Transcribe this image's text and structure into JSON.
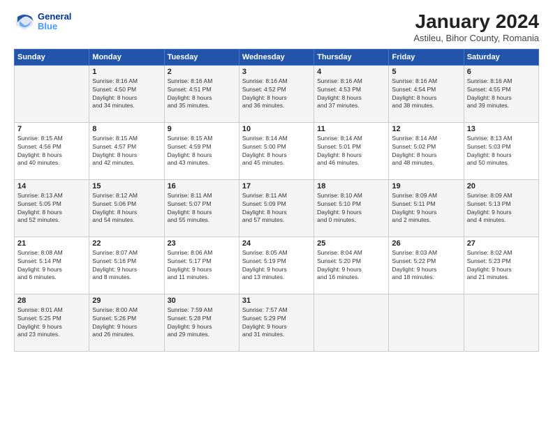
{
  "header": {
    "logo_line1": "General",
    "logo_line2": "Blue",
    "title": "January 2024",
    "subtitle": "Astileu, Bihor County, Romania"
  },
  "days_of_week": [
    "Sunday",
    "Monday",
    "Tuesday",
    "Wednesday",
    "Thursday",
    "Friday",
    "Saturday"
  ],
  "weeks": [
    [
      {
        "day": "",
        "info": ""
      },
      {
        "day": "1",
        "info": "Sunrise: 8:16 AM\nSunset: 4:50 PM\nDaylight: 8 hours\nand 34 minutes."
      },
      {
        "day": "2",
        "info": "Sunrise: 8:16 AM\nSunset: 4:51 PM\nDaylight: 8 hours\nand 35 minutes."
      },
      {
        "day": "3",
        "info": "Sunrise: 8:16 AM\nSunset: 4:52 PM\nDaylight: 8 hours\nand 36 minutes."
      },
      {
        "day": "4",
        "info": "Sunrise: 8:16 AM\nSunset: 4:53 PM\nDaylight: 8 hours\nand 37 minutes."
      },
      {
        "day": "5",
        "info": "Sunrise: 8:16 AM\nSunset: 4:54 PM\nDaylight: 8 hours\nand 38 minutes."
      },
      {
        "day": "6",
        "info": "Sunrise: 8:16 AM\nSunset: 4:55 PM\nDaylight: 8 hours\nand 39 minutes."
      }
    ],
    [
      {
        "day": "7",
        "info": "Sunrise: 8:15 AM\nSunset: 4:56 PM\nDaylight: 8 hours\nand 40 minutes."
      },
      {
        "day": "8",
        "info": "Sunrise: 8:15 AM\nSunset: 4:57 PM\nDaylight: 8 hours\nand 42 minutes."
      },
      {
        "day": "9",
        "info": "Sunrise: 8:15 AM\nSunset: 4:59 PM\nDaylight: 8 hours\nand 43 minutes."
      },
      {
        "day": "10",
        "info": "Sunrise: 8:14 AM\nSunset: 5:00 PM\nDaylight: 8 hours\nand 45 minutes."
      },
      {
        "day": "11",
        "info": "Sunrise: 8:14 AM\nSunset: 5:01 PM\nDaylight: 8 hours\nand 46 minutes."
      },
      {
        "day": "12",
        "info": "Sunrise: 8:14 AM\nSunset: 5:02 PM\nDaylight: 8 hours\nand 48 minutes."
      },
      {
        "day": "13",
        "info": "Sunrise: 8:13 AM\nSunset: 5:03 PM\nDaylight: 8 hours\nand 50 minutes."
      }
    ],
    [
      {
        "day": "14",
        "info": "Sunrise: 8:13 AM\nSunset: 5:05 PM\nDaylight: 8 hours\nand 52 minutes."
      },
      {
        "day": "15",
        "info": "Sunrise: 8:12 AM\nSunset: 5:06 PM\nDaylight: 8 hours\nand 54 minutes."
      },
      {
        "day": "16",
        "info": "Sunrise: 8:11 AM\nSunset: 5:07 PM\nDaylight: 8 hours\nand 55 minutes."
      },
      {
        "day": "17",
        "info": "Sunrise: 8:11 AM\nSunset: 5:09 PM\nDaylight: 8 hours\nand 57 minutes."
      },
      {
        "day": "18",
        "info": "Sunrise: 8:10 AM\nSunset: 5:10 PM\nDaylight: 9 hours\nand 0 minutes."
      },
      {
        "day": "19",
        "info": "Sunrise: 8:09 AM\nSunset: 5:11 PM\nDaylight: 9 hours\nand 2 minutes."
      },
      {
        "day": "20",
        "info": "Sunrise: 8:09 AM\nSunset: 5:13 PM\nDaylight: 9 hours\nand 4 minutes."
      }
    ],
    [
      {
        "day": "21",
        "info": "Sunrise: 8:08 AM\nSunset: 5:14 PM\nDaylight: 9 hours\nand 6 minutes."
      },
      {
        "day": "22",
        "info": "Sunrise: 8:07 AM\nSunset: 5:16 PM\nDaylight: 9 hours\nand 8 minutes."
      },
      {
        "day": "23",
        "info": "Sunrise: 8:06 AM\nSunset: 5:17 PM\nDaylight: 9 hours\nand 11 minutes."
      },
      {
        "day": "24",
        "info": "Sunrise: 8:05 AM\nSunset: 5:19 PM\nDaylight: 9 hours\nand 13 minutes."
      },
      {
        "day": "25",
        "info": "Sunrise: 8:04 AM\nSunset: 5:20 PM\nDaylight: 9 hours\nand 16 minutes."
      },
      {
        "day": "26",
        "info": "Sunrise: 8:03 AM\nSunset: 5:22 PM\nDaylight: 9 hours\nand 18 minutes."
      },
      {
        "day": "27",
        "info": "Sunrise: 8:02 AM\nSunset: 5:23 PM\nDaylight: 9 hours\nand 21 minutes."
      }
    ],
    [
      {
        "day": "28",
        "info": "Sunrise: 8:01 AM\nSunset: 5:25 PM\nDaylight: 9 hours\nand 23 minutes."
      },
      {
        "day": "29",
        "info": "Sunrise: 8:00 AM\nSunset: 5:26 PM\nDaylight: 9 hours\nand 26 minutes."
      },
      {
        "day": "30",
        "info": "Sunrise: 7:59 AM\nSunset: 5:28 PM\nDaylight: 9 hours\nand 29 minutes."
      },
      {
        "day": "31",
        "info": "Sunrise: 7:57 AM\nSunset: 5:29 PM\nDaylight: 9 hours\nand 31 minutes."
      },
      {
        "day": "",
        "info": ""
      },
      {
        "day": "",
        "info": ""
      },
      {
        "day": "",
        "info": ""
      }
    ]
  ]
}
